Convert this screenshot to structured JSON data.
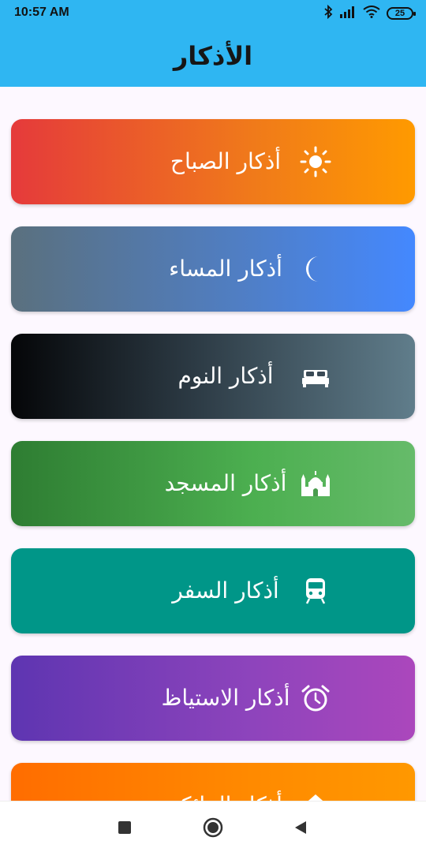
{
  "status_bar": {
    "time": "10:57 AM",
    "battery": "25",
    "icons": [
      "bluetooth-icon",
      "signal-icon",
      "wifi-icon",
      "battery-icon"
    ]
  },
  "app_bar": {
    "title": "الأذكار",
    "background": "#2fb6f2"
  },
  "cards": [
    {
      "label": "أذكار الصباح",
      "icon": "sun-icon"
    },
    {
      "label": "أذكار المساء",
      "icon": "moon-icon"
    },
    {
      "label": "أذكار النوم",
      "icon": "bed-icon"
    },
    {
      "label": "أذكار المسجد",
      "icon": "mosque-icon"
    },
    {
      "label": "أذكار السفر",
      "icon": "train-icon"
    },
    {
      "label": "أذكار الاستياظ",
      "icon": "alarm-clock-icon"
    },
    {
      "label": "أذكار المائكة",
      "icon": "home-icon"
    }
  ],
  "nav_bar": {
    "buttons": [
      "recents-button",
      "home-button",
      "back-button"
    ]
  }
}
